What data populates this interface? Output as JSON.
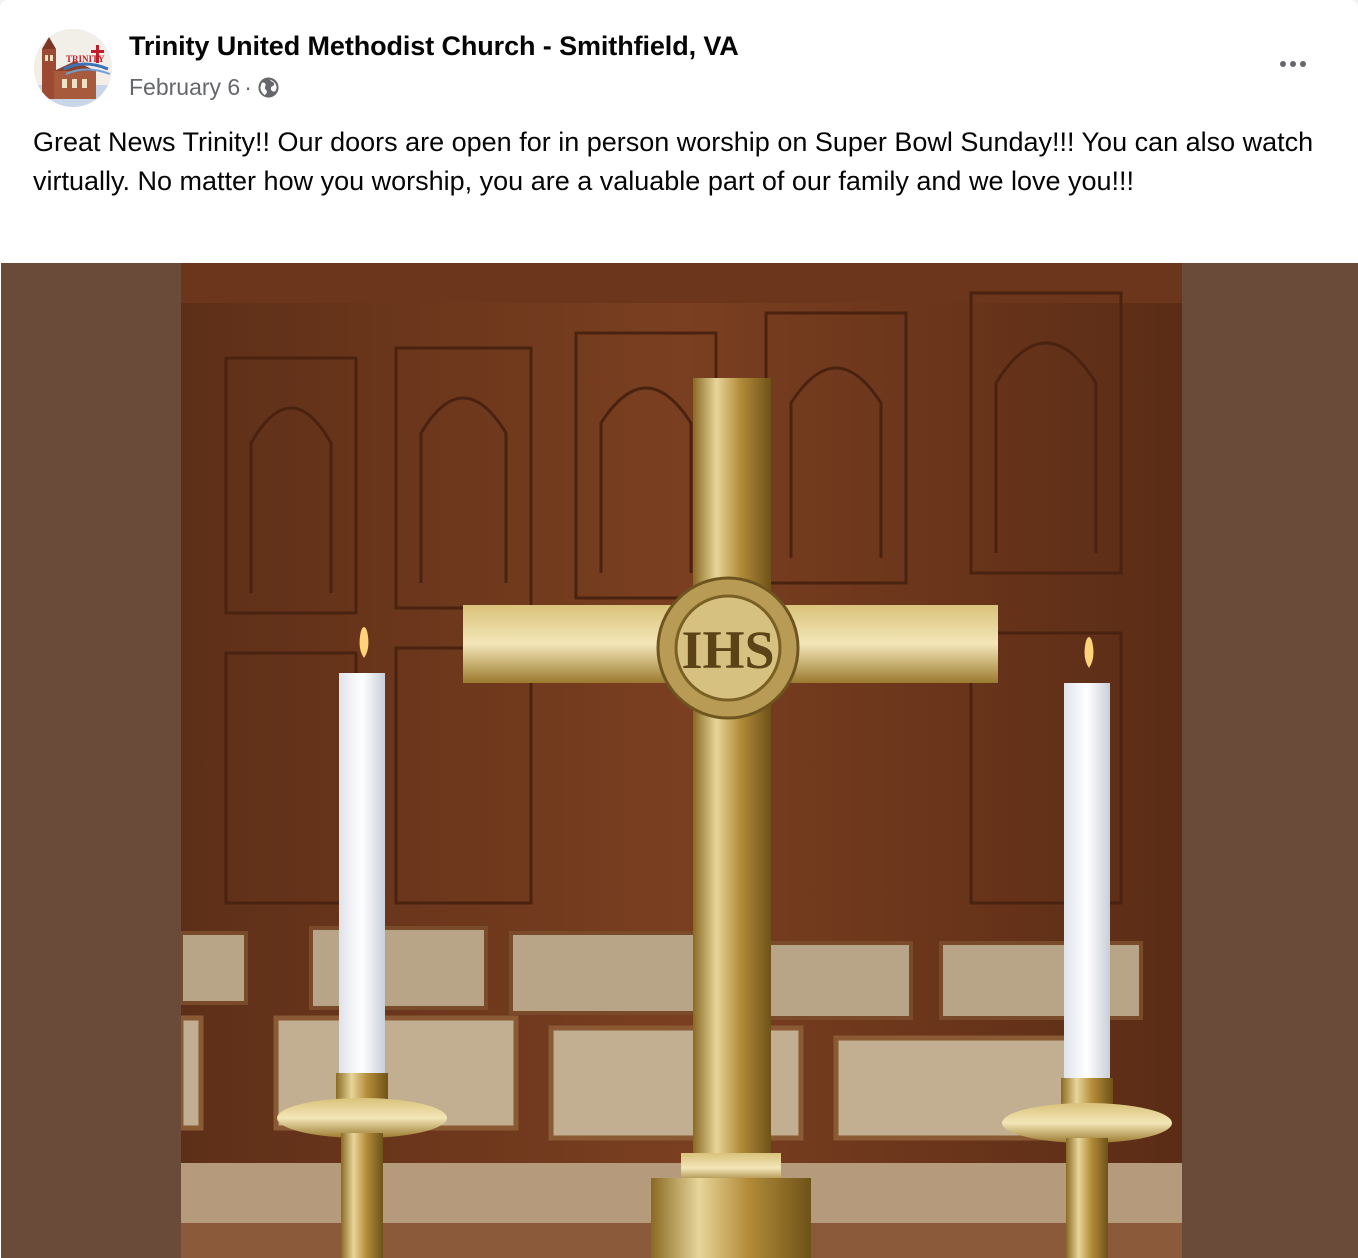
{
  "post": {
    "page_name": "Trinity United Methodist Church - Smithfield, VA",
    "date": "February 6",
    "separator": "·",
    "audience_icon": "globe-icon",
    "more_icon": "more-options-icon",
    "message": "Great News Trinity!! Our doors are open for in person worship on Super Bowl Sunday!!! You can also watch virtually. No matter how you worship, you are a valuable part of our family and we love you!!!",
    "avatar": {
      "logo_text": "TRINITY"
    },
    "photo": {
      "background_color": "#6a4a38",
      "cross_monogram": "IHS"
    }
  }
}
